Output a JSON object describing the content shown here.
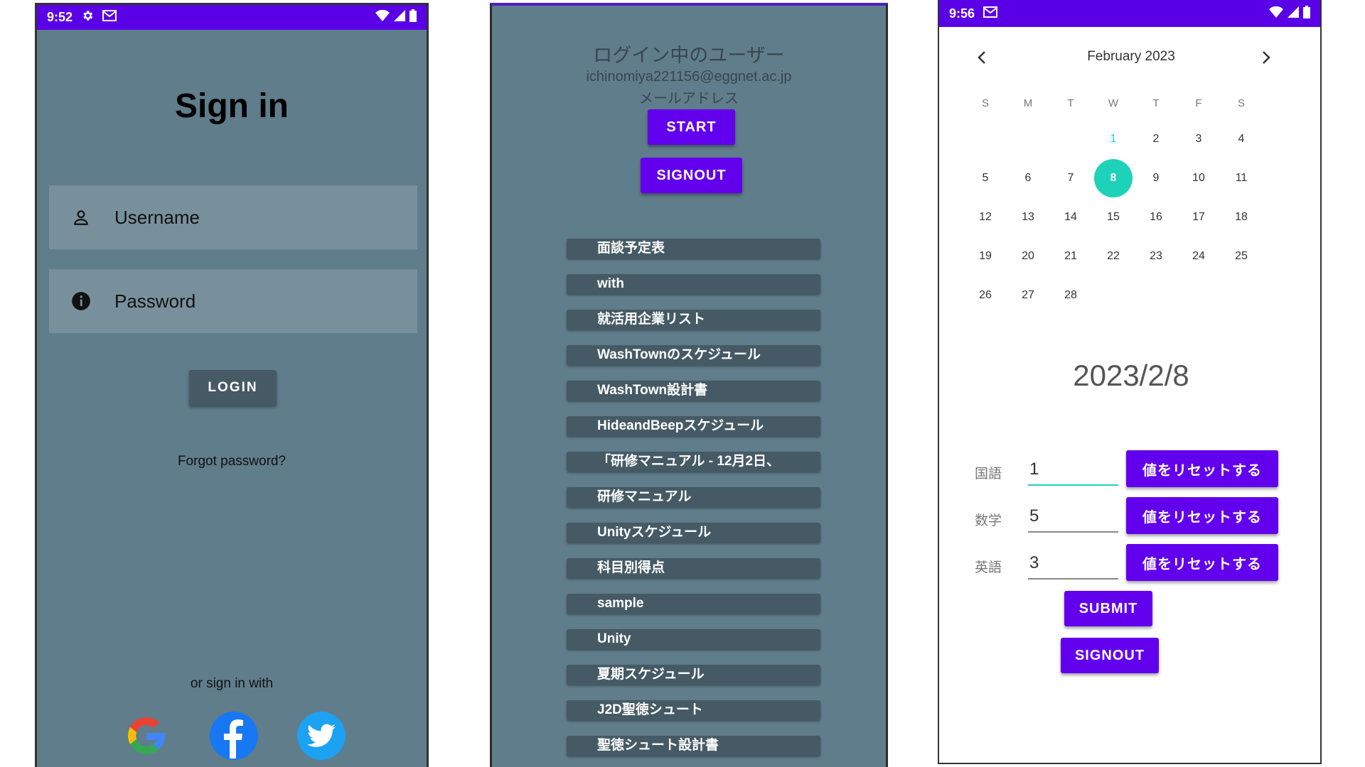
{
  "signin": {
    "status_time": "9:52",
    "title": "Sign in",
    "username_placeholder": "Username",
    "password_placeholder": "Password",
    "login_label": "LOGIN",
    "forgot_label": "Forgot password?",
    "or_sign_in_with": "or sign in with",
    "social": [
      "google-icon",
      "facebook-icon",
      "twitter-icon"
    ]
  },
  "list": {
    "title": "ログイン中のユーザー",
    "email": "ichinomiya221156@eggnet.ac.jp",
    "mail_label": "メールアドレス",
    "start_label": "START",
    "signout_label": "SIGNOUT",
    "items": [
      "面談予定表",
      "with",
      "就活用企業リスト",
      "WashTownのスケジュール",
      "WashTown設計書",
      "HideandBeepスケジュール",
      "「研修マニュアル - 12月2日、",
      "研修マニュアル",
      "Unityスケジュール",
      "科目別得点",
      "sample",
      "Unity",
      "夏期スケジュール",
      "J2D聖徳シュート",
      "聖徳シュート設計書"
    ]
  },
  "calendar": {
    "status_time": "9:56",
    "month": "February 2023",
    "weekdays": [
      "S",
      "M",
      "T",
      "W",
      "T",
      "F",
      "S"
    ],
    "weeks": [
      [
        "",
        "",
        "",
        "1",
        "2",
        "3",
        "4"
      ],
      [
        "5",
        "6",
        "7",
        "8",
        "9",
        "10",
        "11"
      ],
      [
        "12",
        "13",
        "14",
        "15",
        "16",
        "17",
        "18"
      ],
      [
        "19",
        "20",
        "21",
        "22",
        "23",
        "24",
        "25"
      ],
      [
        "26",
        "27",
        "28",
        "",
        "",
        "",
        ""
      ]
    ],
    "today": "1",
    "selected": "8",
    "selected_date": "2023/2/8",
    "scores": [
      {
        "subject": "国語",
        "value": "1"
      },
      {
        "subject": "数学",
        "value": "5"
      },
      {
        "subject": "英語",
        "value": "3"
      }
    ],
    "reset_label": "値をリセットする",
    "submit_label": "SUBMIT",
    "signout_label": "SIGNOUT"
  },
  "colors": {
    "status_bar": "#5a00e6",
    "phone_bg": "#607d8b",
    "field_bg": "#78909c",
    "dark_button": "#455a64",
    "purple_button": "#6200ee",
    "accent_teal": "#1ed2b9"
  }
}
